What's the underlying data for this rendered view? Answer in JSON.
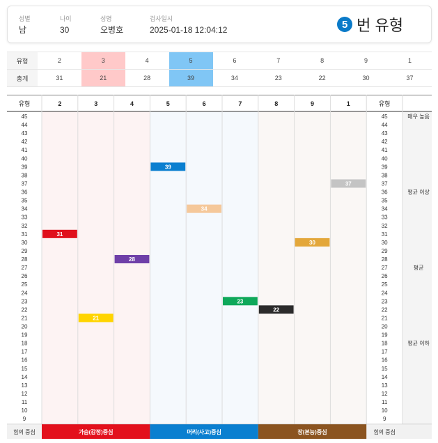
{
  "header": {
    "fields": [
      {
        "label": "성별",
        "value": "남"
      },
      {
        "label": "나이",
        "value": "30"
      },
      {
        "label": "성명",
        "value": "오병호"
      },
      {
        "label": "검사일시",
        "value": "2025-01-18 12:04:12"
      }
    ],
    "type_number": "5",
    "type_suffix": "번 유형"
  },
  "summary": {
    "row_labels": [
      "유형",
      "총계"
    ],
    "types": [
      "2",
      "3",
      "4",
      "5",
      "6",
      "7",
      "8",
      "9",
      "1"
    ],
    "totals": [
      "31",
      "21",
      "28",
      "39",
      "34",
      "23",
      "22",
      "30",
      "37"
    ],
    "highlight": {
      "3": "#ffc9c9",
      "5": "#80c6f5"
    }
  },
  "chart_data": {
    "type": "bar",
    "header_label": "유형",
    "categories": [
      "2",
      "3",
      "4",
      "5",
      "6",
      "7",
      "8",
      "9",
      "1"
    ],
    "values": [
      31,
      21,
      28,
      39,
      34,
      23,
      22,
      30,
      37
    ],
    "bar_colors": [
      "#e0101c",
      "#ffd400",
      "#6f3fa8",
      "#0a7fd0",
      "#f5c89a",
      "#0ea85a",
      "#2b2b2b",
      "#e3a73a",
      "#c4c4c4"
    ],
    "ylim": [
      9,
      45
    ],
    "y_ticks": [
      45,
      44,
      43,
      42,
      41,
      40,
      39,
      38,
      37,
      36,
      35,
      34,
      33,
      32,
      31,
      30,
      29,
      28,
      27,
      26,
      25,
      24,
      23,
      22,
      21,
      20,
      19,
      18,
      17,
      16,
      15,
      14,
      13,
      12,
      11,
      10,
      9
    ],
    "bands": [
      {
        "label": "매우 높음",
        "at": 45
      },
      {
        "label": "평균 이상",
        "at": 36
      },
      {
        "label": "평균",
        "at": 27
      },
      {
        "label": "평균 이하",
        "at": 18
      }
    ],
    "centers_label": "힘의 중심",
    "centers": [
      {
        "label": "가슴(감정)중심",
        "color": "#e3101c",
        "columns": 3
      },
      {
        "label": "머리(사고)중심",
        "color": "#0a7fd0",
        "columns": 3
      },
      {
        "label": "장(본능)중심",
        "color": "#8b5420",
        "columns": 3
      }
    ],
    "column_tints": [
      "#fdf3f3",
      "#f5f9fd",
      "#faf7f5"
    ]
  }
}
